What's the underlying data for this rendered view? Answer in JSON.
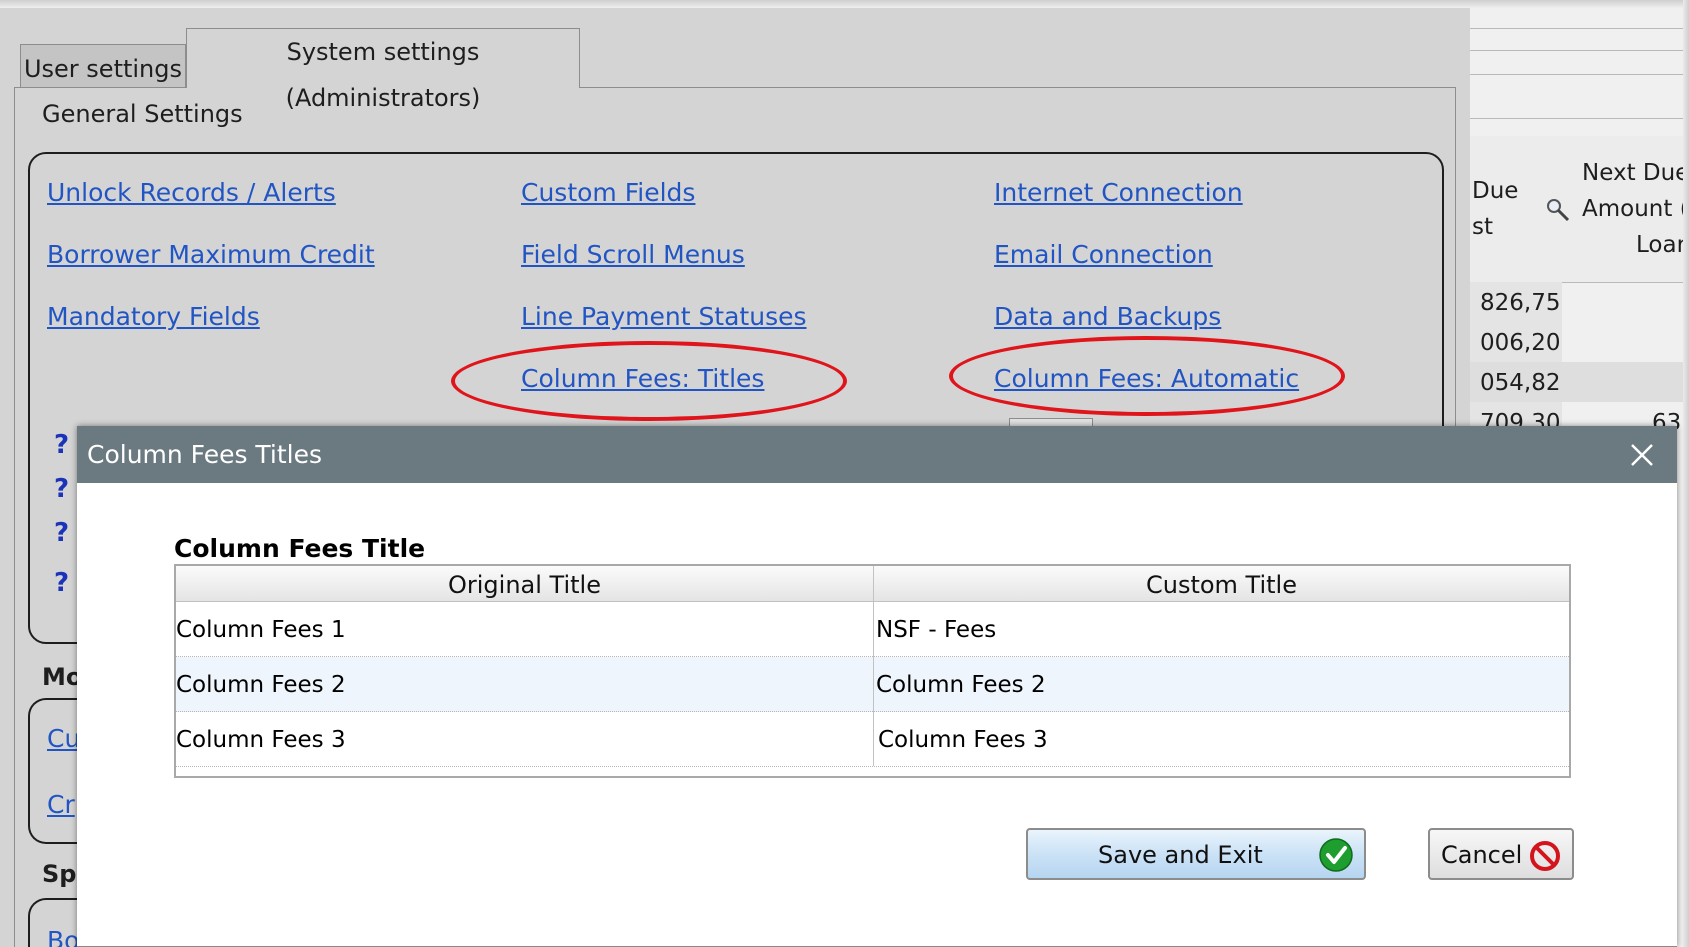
{
  "tabs": [
    {
      "label": "User settings",
      "active": false
    },
    {
      "label": "System settings (Administrators)",
      "active": true
    }
  ],
  "general": {
    "heading": "General Settings",
    "links": [
      "Unlock Records / Alerts",
      "Borrower Maximum Credit",
      "Mandatory Fields",
      "Custom Fields",
      "Field Scroll Menus",
      "Line Payment Statuses",
      "Column Fees: Titles",
      "Internet Connection",
      "Email Connection",
      "Data and Backups",
      "Column Fees: Automatic"
    ],
    "help_marks": [
      "?",
      "?",
      "?",
      "?"
    ]
  },
  "lower": {
    "heading1": "Mo",
    "links1": [
      "Cu",
      "Cr"
    ],
    "heading2": "Sp",
    "links2": [
      "Bo"
    ]
  },
  "background_table": {
    "headers": [
      "Due",
      "st",
      "Next Due",
      "Amount (",
      "Loar"
    ],
    "cells": [
      "826,75",
      "006,20",
      "054,82",
      "709,30",
      "63"
    ]
  },
  "dialog": {
    "title": "Column Fees Titles",
    "grid_caption": "Column Fees Title",
    "columns": [
      "Original Title",
      "Custom Title"
    ],
    "rows": [
      [
        "Column Fees 1",
        "NSF - Fees"
      ],
      [
        "Column Fees 2",
        "Column Fees 2"
      ],
      [
        "Column Fees 3",
        "Column Fees 3"
      ]
    ],
    "selected_row": 1,
    "save_label": "Save and Exit",
    "cancel_label": "Cancel"
  },
  "colors": {
    "link": "#2255c4",
    "highlight_ellipse": "#e0151b",
    "titlebar": "#6b7a80",
    "save_check": "#1e9e2f",
    "cancel_icon": "#d4141d",
    "selected_row": "#eef5fc"
  },
  "icons": {
    "close": "close-icon",
    "search": "magnifier-icon",
    "save": "checkmark-circle-icon",
    "cancel": "prohibited-icon"
  }
}
